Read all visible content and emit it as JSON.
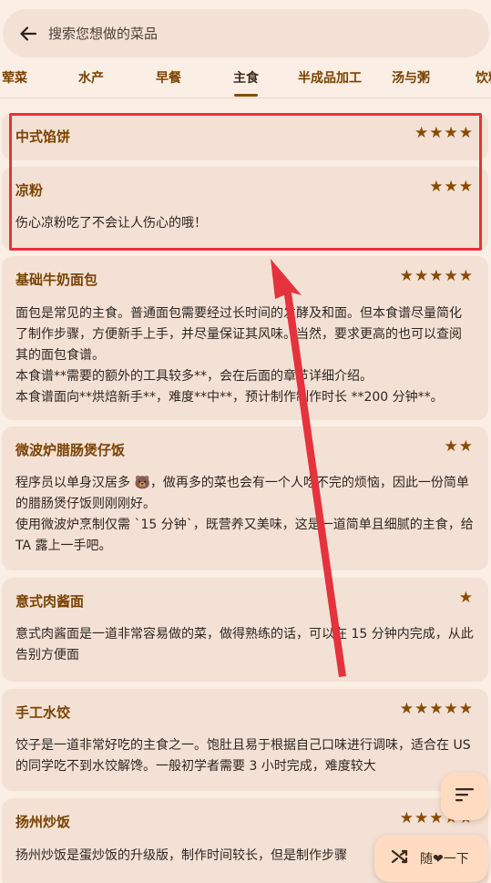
{
  "search": {
    "placeholder": "搜索您想做的菜品"
  },
  "tabs": [
    {
      "label": "荤菜"
    },
    {
      "label": "水产"
    },
    {
      "label": "早餐"
    },
    {
      "label": "主食",
      "active": true
    },
    {
      "label": "半成品加工"
    },
    {
      "label": "汤与粥"
    },
    {
      "label": "饮料"
    }
  ],
  "recipes": [
    {
      "title": "中式馅饼",
      "stars": "★★★★",
      "description": ""
    },
    {
      "title": "凉粉",
      "stars": "★★★",
      "description": "伤心凉粉吃了不会让人伤心的哦！"
    },
    {
      "title": "基础牛奶面包",
      "stars": "★★★★★",
      "description": "面包是常见的主食。普通面包需要经过长时间的发酵及和面。但本食谱尽量简化了制作步骤，方便新手上手，并尽量保证其风味。当然，要求更高的也可以查阅其的面包食谱。\n本食谱**需要的额外的工具较多**，会在后面的章节详细介绍。\n本食谱面向**烘焙新手**，难度**中**，预计制作制作时长 **200 分钟**。"
    },
    {
      "title": "微波炉腊肠煲仔饭",
      "stars": "★★",
      "description": "程序员以单身汉居多 🐻，做再多的菜也会有一个人吃不完的烦恼，因此一份简单的腊肠煲仔饭则刚刚好。\n使用微波炉烹制仅需 `15 分钟`，既营养又美味，这是一道简单且细腻的主食，给 TA 露上一手吧。"
    },
    {
      "title": "意式肉酱面",
      "stars": "★",
      "description": "意式肉酱面是一道非常容易做的菜，做得熟练的话，可以在 15 分钟内完成，从此告别方便面"
    },
    {
      "title": "手工水饺",
      "stars": "★★★★★",
      "description": "饺子是一道非常好吃的主食之一。饱肚且易于根据自己口味进行调味，适合在 US 的同学吃不到水饺解馋。一般初学者需要 3 小时完成，难度较大"
    },
    {
      "title": "扬州炒饭",
      "stars": "★★★★★",
      "description": "扬州炒饭是蛋炒饭的升级版，制作时间较长，但是制作步骤"
    }
  ],
  "fab": {
    "random_label": "随❤一下"
  },
  "colors": {
    "accent": "#8a4b00",
    "card": "#f3e1d5",
    "background": "#fbeee4",
    "highlight": "#e5323d"
  },
  "icons": {
    "back": "arrow-left-icon",
    "sort": "sort-icon",
    "shuffle": "shuffle-icon"
  }
}
